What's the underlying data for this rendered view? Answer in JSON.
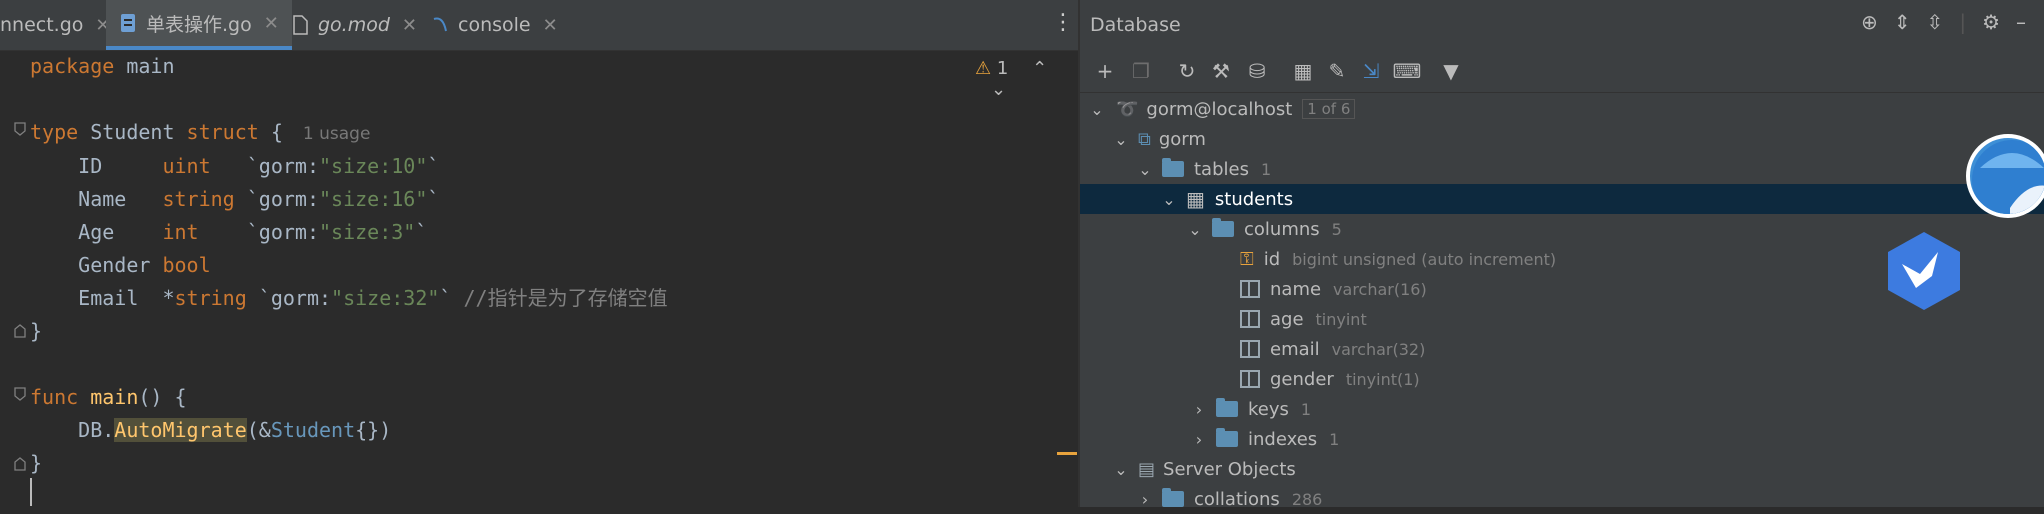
{
  "tabs": [
    {
      "label": "nnect.go",
      "active": false
    },
    {
      "label": "单表操作.go",
      "active": true
    },
    {
      "label": "go.mod",
      "active": false
    },
    {
      "label": "console",
      "active": false
    }
  ],
  "editor": {
    "warning_count": "1",
    "code": {
      "l1_kw": "package",
      "l1_name": " main",
      "l2_kw": "type",
      "l2_name": " Student ",
      "l2_kw2": "struct",
      "l2_rest": " {",
      "l2_usage": "1 usage",
      "f1_name": "    ID     ",
      "f1_type": "uint",
      "f1_pre": "   `gorm:",
      "f1_str": "\"size:10\"",
      "f1_post": "`",
      "f2_name": "    Name   ",
      "f2_type": "string",
      "f2_pre": " `gorm:",
      "f2_str": "\"size:16\"",
      "f2_post": "`",
      "f3_name": "    Age    ",
      "f3_type": "int",
      "f3_pre": "    `gorm:",
      "f3_str": "\"size:3\"",
      "f3_post": "`",
      "f4_name": "    Gender ",
      "f4_type": "bool",
      "f5_name": "    Email  ",
      "f5_ptr": "*",
      "f5_type": "string",
      "f5_pre": " `gorm:",
      "f5_str": "\"size:32\"",
      "f5_post": "` ",
      "f5_comment": "//指针是为了存储空值",
      "close1": "}",
      "l3_kw": "func",
      "l3_fn": " main",
      "l3_rest": "() {",
      "l4_pre": "    DB.",
      "l4_fn": "AutoMigrate",
      "l4_mid": "(&",
      "l4_type": "Student",
      "l4_post": "{})",
      "close2": "}"
    }
  },
  "database": {
    "title": "Database",
    "tree": {
      "connection": {
        "label": "gorm@localhost",
        "badge": "1 of 6"
      },
      "schema": {
        "label": "gorm"
      },
      "tables": {
        "label": "tables",
        "count": "1"
      },
      "table": {
        "label": "students"
      },
      "columns": {
        "label": "columns",
        "count": "5"
      },
      "cols": [
        {
          "name": "id",
          "type": "bigint unsigned (auto increment)"
        },
        {
          "name": "name",
          "type": "varchar(16)"
        },
        {
          "name": "age",
          "type": "tinyint"
        },
        {
          "name": "email",
          "type": "varchar(32)"
        },
        {
          "name": "gender",
          "type": "tinyint(1)"
        }
      ],
      "keys": {
        "label": "keys",
        "count": "1"
      },
      "indexes": {
        "label": "indexes",
        "count": "1"
      },
      "server_objects": {
        "label": "Server Objects"
      },
      "collations": {
        "label": "collations",
        "count": "286"
      }
    }
  },
  "colors": {
    "accent": "#4a88c7",
    "selection": "#0d293e",
    "keyword": "#cc7832",
    "string": "#6a8759"
  }
}
